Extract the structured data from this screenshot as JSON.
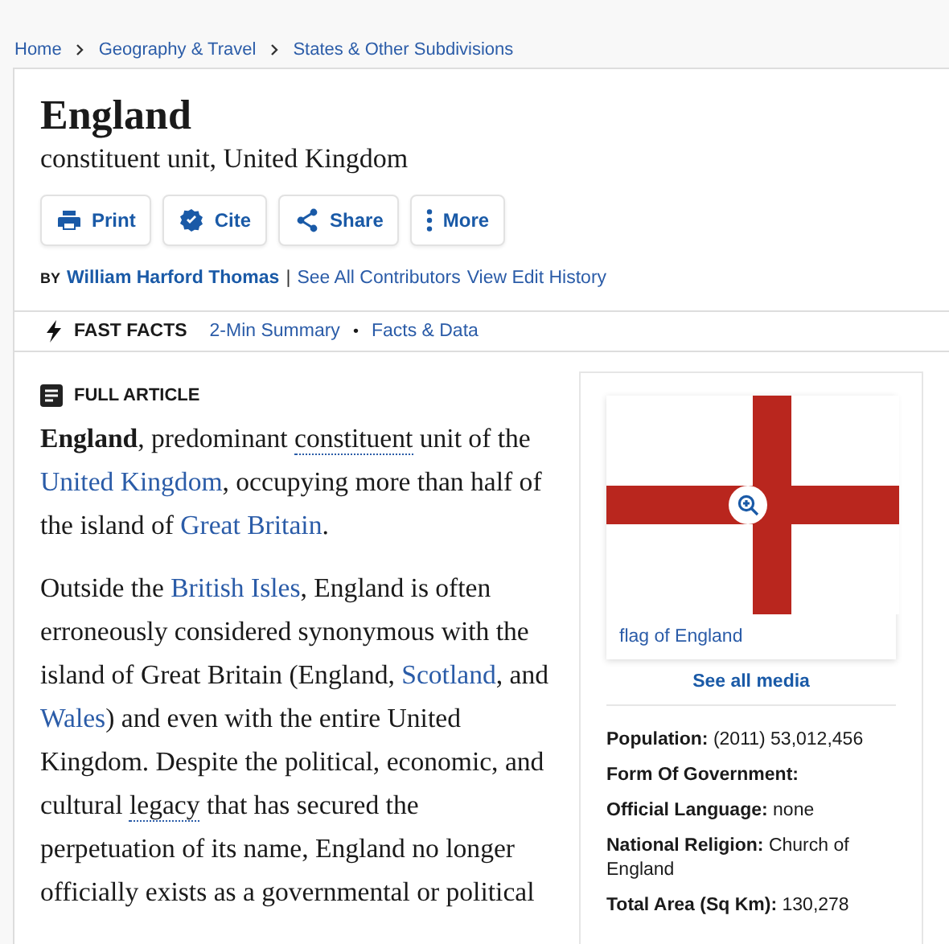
{
  "breadcrumb": [
    "Home",
    "Geography & Travel",
    "States & Other Subdivisions"
  ],
  "title": "England",
  "subtitle": "constituent unit, United Kingdom",
  "actions": [
    {
      "label": "Print",
      "kind": "print"
    },
    {
      "label": "Cite",
      "kind": "cite"
    },
    {
      "label": "Share",
      "kind": "share"
    },
    {
      "label": "More",
      "kind": "more"
    }
  ],
  "byline": {
    "prefix": "BY",
    "author": "William Harford Thomas",
    "separator": "|",
    "links": [
      "See All Contributors",
      "View Edit History"
    ]
  },
  "fast_facts": {
    "label": "FAST FACTS",
    "links": [
      "2-Min Summary",
      "Facts & Data"
    ],
    "separator": "•"
  },
  "article": {
    "label": "FULL ARTICLE",
    "paragraphs": [
      [
        {
          "kind": "bold",
          "text": "England"
        },
        {
          "kind": "text",
          "text": ", predominant "
        },
        {
          "kind": "term",
          "text": "constituent"
        },
        {
          "kind": "text",
          "text": " unit of the "
        },
        {
          "kind": "link",
          "text": "United Kingdom"
        },
        {
          "kind": "text",
          "text": ", occupying more than half of the island of "
        },
        {
          "kind": "link",
          "text": "Great Britain"
        },
        {
          "kind": "text",
          "text": "."
        }
      ],
      [
        {
          "kind": "text",
          "text": "Outside the "
        },
        {
          "kind": "link",
          "text": "British Isles"
        },
        {
          "kind": "text",
          "text": ", England is often erroneously considered synonymous with the island of Great Britain (England, "
        },
        {
          "kind": "link",
          "text": "Scotland"
        },
        {
          "kind": "text",
          "text": ", and "
        },
        {
          "kind": "link",
          "text": "Wales"
        },
        {
          "kind": "text",
          "text": ") and even with the entire United Kingdom. Despite the political, economic, and cultural "
        },
        {
          "kind": "term",
          "text": "legacy"
        },
        {
          "kind": "text",
          "text": " that has secured the perpetuation of its name, England no longer officially exists as a governmental or political"
        }
      ]
    ]
  },
  "media": {
    "caption": "flag of England",
    "see_all": "See all media"
  },
  "facts": [
    {
      "label": "Population:",
      "value": "(2011) 53,012,456"
    },
    {
      "label": "Form Of Government:"
    },
    {
      "label": "Official Language:",
      "value": "none"
    },
    {
      "label": "National Religion:",
      "value": "Church of England"
    },
    {
      "label": "Total Area (Sq Km):",
      "value": "130,278"
    }
  ]
}
